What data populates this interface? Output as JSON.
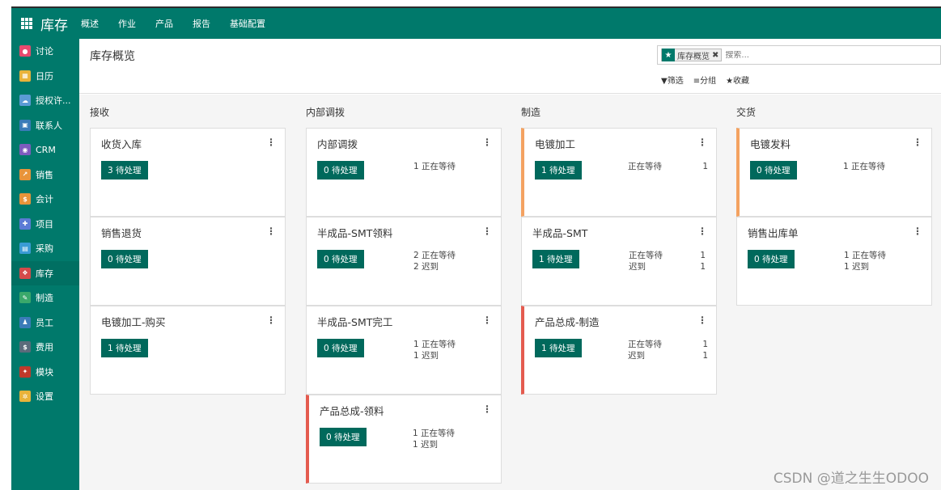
{
  "navbar": {
    "brand": "库存",
    "menu": [
      "概述",
      "作业",
      "产品",
      "报告",
      "基础配置"
    ]
  },
  "sidebar": {
    "items": [
      {
        "label": "讨论",
        "icon": "chat-icon",
        "color": "#e84a6f",
        "glyph": "●"
      },
      {
        "label": "日历",
        "icon": "calendar-icon",
        "color": "#e8b33a",
        "glyph": "▦"
      },
      {
        "label": "授权许...",
        "icon": "cloud-icon",
        "color": "#5b9bd5",
        "glyph": "☁"
      },
      {
        "label": "联系人",
        "icon": "contact-card-icon",
        "color": "#3a7bb8",
        "glyph": "▣"
      },
      {
        "label": "CRM",
        "icon": "handshake-icon",
        "color": "#7d5bbe",
        "glyph": "◉"
      },
      {
        "label": "销售",
        "icon": "chart-icon",
        "color": "#e8943a",
        "glyph": "↗"
      },
      {
        "label": "会计",
        "icon": "invoice-icon",
        "color": "#e8943a",
        "glyph": "$"
      },
      {
        "label": "项目",
        "icon": "puzzle-icon",
        "color": "#5b7bd5",
        "glyph": "✚"
      },
      {
        "label": "采购",
        "icon": "purchase-icon",
        "color": "#3a9bd5",
        "glyph": "▤"
      },
      {
        "label": "库存",
        "icon": "boxes-icon",
        "color": "#d54a4a",
        "glyph": "❖"
      },
      {
        "label": "制造",
        "icon": "wrench-icon",
        "color": "#3aa86b",
        "glyph": "✎"
      },
      {
        "label": "员工",
        "icon": "people-icon",
        "color": "#3a7bb8",
        "glyph": "♟"
      },
      {
        "label": "费用",
        "icon": "expense-icon",
        "color": "#5b6b7b",
        "glyph": "$"
      },
      {
        "label": "模块",
        "icon": "modules-icon",
        "color": "#c0392b",
        "glyph": "✦"
      },
      {
        "label": "设置",
        "icon": "settings-icon",
        "color": "#e8b33a",
        "glyph": "✲"
      }
    ],
    "active_index": 9
  },
  "control": {
    "title": "库存概览",
    "facet_label": "库存概览",
    "search_placeholder": "搜索...",
    "filter_label": "▼筛选",
    "group_label": "≡分组",
    "favorite_label": "★收藏"
  },
  "columns": [
    {
      "title": "接收",
      "cards": [
        {
          "title": "收货入库",
          "button": "3 待处理",
          "stripe": "",
          "stats": []
        },
        {
          "title": "销售退货",
          "button": "0 待处理",
          "stripe": "",
          "stats": []
        },
        {
          "title": "电镀加工-购买",
          "button": "1 待处理",
          "stripe": "",
          "stats": []
        }
      ]
    },
    {
      "title": "内部调拨",
      "cards": [
        {
          "title": "内部调拨",
          "button": "0 待处理",
          "stripe": "",
          "stats": [
            {
              "label": "1 正在等待",
              "num": ""
            }
          ]
        },
        {
          "title": "半成品-SMT领料",
          "button": "0 待处理",
          "stripe": "",
          "stats": [
            {
              "label": "2 正在等待",
              "num": ""
            },
            {
              "label": "2 迟到",
              "num": ""
            }
          ]
        },
        {
          "title": "半成品-SMT完工",
          "button": "0 待处理",
          "stripe": "",
          "stats": [
            {
              "label": "1 正在等待",
              "num": ""
            },
            {
              "label": "1 迟到",
              "num": ""
            }
          ]
        },
        {
          "title": "产品总成-领料",
          "button": "0 待处理",
          "stripe": "red",
          "stats": [
            {
              "label": "1 正在等待",
              "num": ""
            },
            {
              "label": "1 迟到",
              "num": ""
            }
          ]
        }
      ]
    },
    {
      "title": "制造",
      "cards": [
        {
          "title": "电镀加工",
          "button": "1 待处理",
          "stripe": "orange",
          "stats": [
            {
              "label": "正在等待",
              "num": "1"
            }
          ]
        },
        {
          "title": "半成品-SMT",
          "button": "1 待处理",
          "stripe": "",
          "stats": [
            {
              "label": "正在等待",
              "num": "1"
            },
            {
              "label": "迟到",
              "num": "1"
            }
          ]
        },
        {
          "title": "产品总成-制造",
          "button": "1 待处理",
          "stripe": "red",
          "stats": [
            {
              "label": "正在等待",
              "num": "1"
            },
            {
              "label": "迟到",
              "num": "1"
            }
          ]
        }
      ]
    },
    {
      "title": "交货",
      "cards": [
        {
          "title": "电镀发料",
          "button": "0 待处理",
          "stripe": "orange",
          "stats": [
            {
              "label": "1 正在等待",
              "num": ""
            }
          ]
        },
        {
          "title": "销售出库单",
          "button": "0 待处理",
          "stripe": "",
          "stats": [
            {
              "label": "1 正在等待",
              "num": ""
            },
            {
              "label": "1 迟到",
              "num": ""
            }
          ]
        }
      ]
    }
  ],
  "watermark": "CSDN @道之生生ODOO",
  "colors": {
    "brand": "#00796b",
    "button": "#00695c",
    "stripe_orange": "#f4a261",
    "stripe_red": "#e45b4f"
  }
}
